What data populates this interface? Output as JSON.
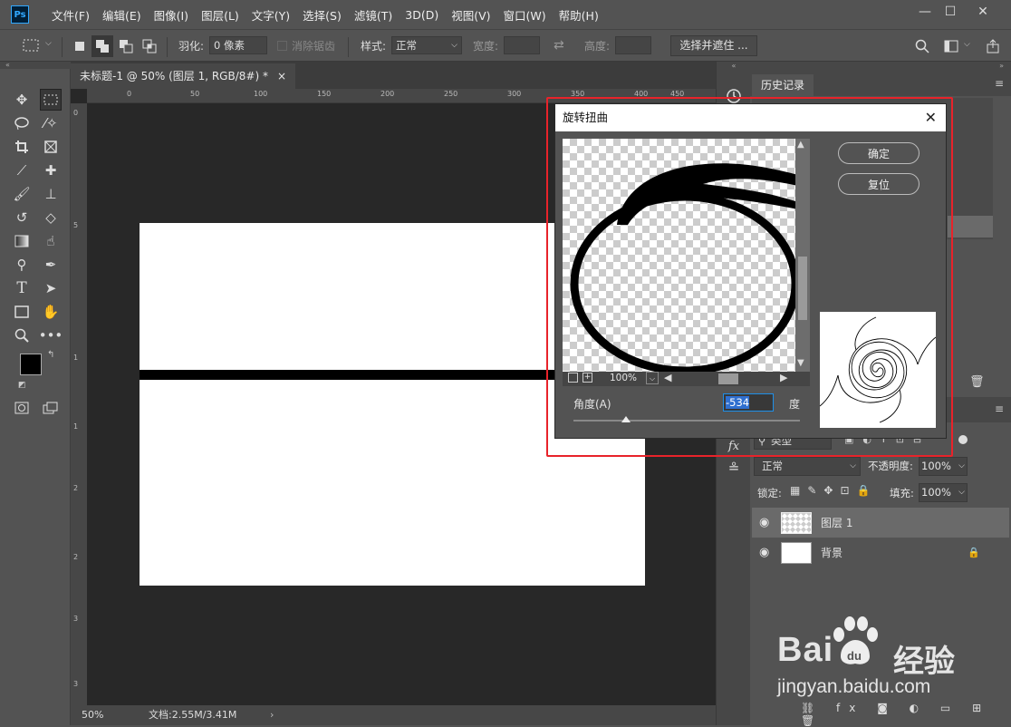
{
  "app": {
    "logo": "Ps"
  },
  "menu": [
    "文件(F)",
    "编辑(E)",
    "图像(I)",
    "图层(L)",
    "文字(Y)",
    "选择(S)",
    "滤镜(T)",
    "3D(D)",
    "视图(V)",
    "窗口(W)",
    "帮助(H)"
  ],
  "options": {
    "feather_label": "羽化:",
    "feather_value": "0 像素",
    "antialias_label": "消除锯齿",
    "style_label": "样式:",
    "style_value": "正常",
    "width_label": "宽度:",
    "height_label": "高度:",
    "select_mask_button": "选择并遮住 ..."
  },
  "document": {
    "tab_title": "未标题-1 @ 50% (图层 1, RGB/8#) *",
    "close": "×",
    "zoom": "50%",
    "doc_info": "文档:2.55M/3.41M",
    "ruler_h": [
      "0",
      "50",
      "100",
      "150",
      "200",
      "250",
      "300",
      "350",
      "400",
      "450"
    ],
    "ruler_v": [
      "0",
      "5",
      "1",
      "1",
      "2",
      "2",
      "3",
      "3"
    ]
  },
  "history_panel": {
    "tab": "历史记录"
  },
  "layers_panel": {
    "filter_value": "类型",
    "blend_mode": "正常",
    "opacity_label": "不透明度:",
    "opacity_value": "100%",
    "lock_label": "锁定:",
    "fill_label": "填充:",
    "fill_value": "100%",
    "layers": [
      {
        "name": "图层 1",
        "selected": true
      },
      {
        "name": "背景",
        "locked": true
      }
    ]
  },
  "dialog": {
    "title": "旋转扭曲",
    "ok_button": "确定",
    "reset_button": "复位",
    "zoom_value": "100%",
    "angle_label": "角度(A)",
    "angle_value": "-534",
    "angle_unit": "度",
    "highlight_color": "#e8232a"
  },
  "watermark": {
    "brand": "Bai",
    "brand2": "du",
    "product": "经验",
    "url": "jingyan.baidu.com"
  }
}
